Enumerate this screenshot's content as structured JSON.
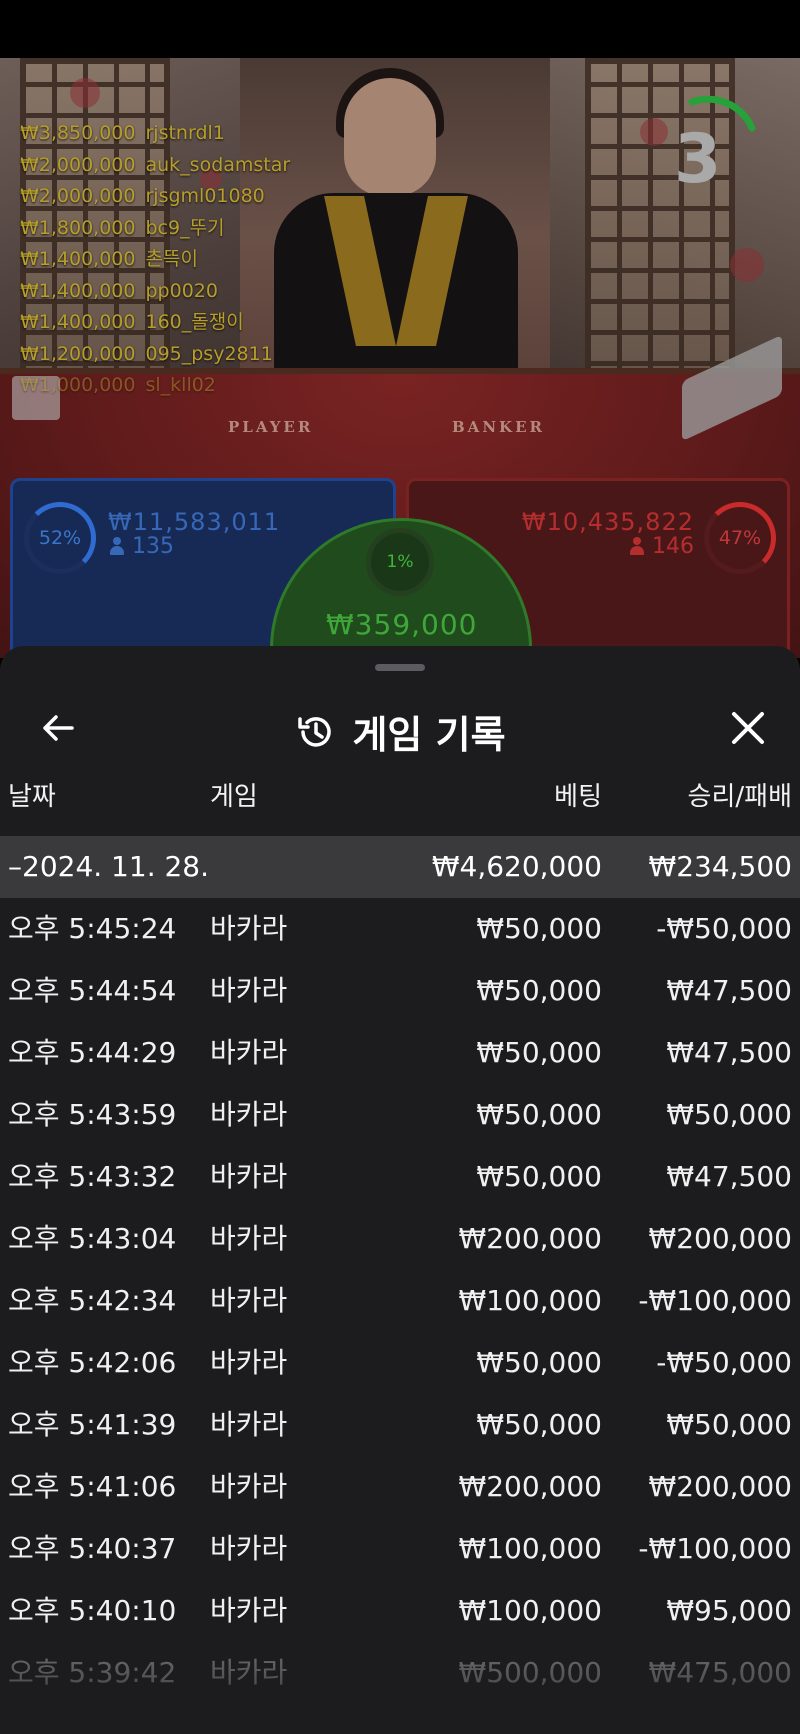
{
  "live_video": {
    "felt_labels": {
      "player": "PLAYER",
      "banker": "BANKER"
    },
    "countdown": "3",
    "recent_bets": [
      {
        "amount": "₩3,850,000",
        "user": "rjstnrdl1"
      },
      {
        "amount": "₩2,000,000",
        "user": "auk_sodamstar"
      },
      {
        "amount": "₩2,000,000",
        "user": "rjsgml01080"
      },
      {
        "amount": "₩1,800,000",
        "user": "bc9_뚜기"
      },
      {
        "amount": "₩1,400,000",
        "user": "촌뜩이"
      },
      {
        "amount": "₩1,400,000",
        "user": "pp0020"
      },
      {
        "amount": "₩1,400,000",
        "user": "160_돌쟁이"
      },
      {
        "amount": "₩1,200,000",
        "user": "095_psy2811"
      },
      {
        "amount": "₩1,000,000",
        "user": "sl_kll02"
      }
    ]
  },
  "bet_zones": {
    "player": {
      "percent": "52%",
      "amount": "₩11,583,011",
      "players": "135",
      "color": "#2f6bd1"
    },
    "banker": {
      "percent": "47%",
      "amount": "₩10,435,822",
      "players": "146",
      "color": "#c92b2b"
    },
    "tie": {
      "percent": "1%",
      "amount": "₩359,000",
      "color": "#3fb53a"
    }
  },
  "history": {
    "title": "게임 기록",
    "icons": {
      "back": "arrow-left-icon",
      "title": "history-icon",
      "close": "close-icon"
    },
    "columns": {
      "date": "날짜",
      "game": "게임",
      "bet": "베팅",
      "result": "승리/패배"
    },
    "summary": {
      "date": "–2024. 11. 28.",
      "bet": "₩4,620,000",
      "result": "₩234,500"
    },
    "rows": [
      {
        "time": "오후 5:45:24",
        "game": "바카라",
        "bet": "₩50,000",
        "result": "-₩50,000"
      },
      {
        "time": "오후 5:44:54",
        "game": "바카라",
        "bet": "₩50,000",
        "result": "₩47,500"
      },
      {
        "time": "오후 5:44:29",
        "game": "바카라",
        "bet": "₩50,000",
        "result": "₩47,500"
      },
      {
        "time": "오후 5:43:59",
        "game": "바카라",
        "bet": "₩50,000",
        "result": "₩50,000"
      },
      {
        "time": "오후 5:43:32",
        "game": "바카라",
        "bet": "₩50,000",
        "result": "₩47,500"
      },
      {
        "time": "오후 5:43:04",
        "game": "바카라",
        "bet": "₩200,000",
        "result": "₩200,000"
      },
      {
        "time": "오후 5:42:34",
        "game": "바카라",
        "bet": "₩100,000",
        "result": "-₩100,000"
      },
      {
        "time": "오후 5:42:06",
        "game": "바카라",
        "bet": "₩50,000",
        "result": "-₩50,000"
      },
      {
        "time": "오후 5:41:39",
        "game": "바카라",
        "bet": "₩50,000",
        "result": "₩50,000"
      },
      {
        "time": "오후 5:41:06",
        "game": "바카라",
        "bet": "₩200,000",
        "result": "₩200,000"
      },
      {
        "time": "오후 5:40:37",
        "game": "바카라",
        "bet": "₩100,000",
        "result": "-₩100,000"
      },
      {
        "time": "오후 5:40:10",
        "game": "바카라",
        "bet": "₩100,000",
        "result": "₩95,000"
      },
      {
        "time": "오후 5:39:42",
        "game": "바카라",
        "bet": "₩500,000",
        "result": "₩475,000"
      }
    ]
  }
}
